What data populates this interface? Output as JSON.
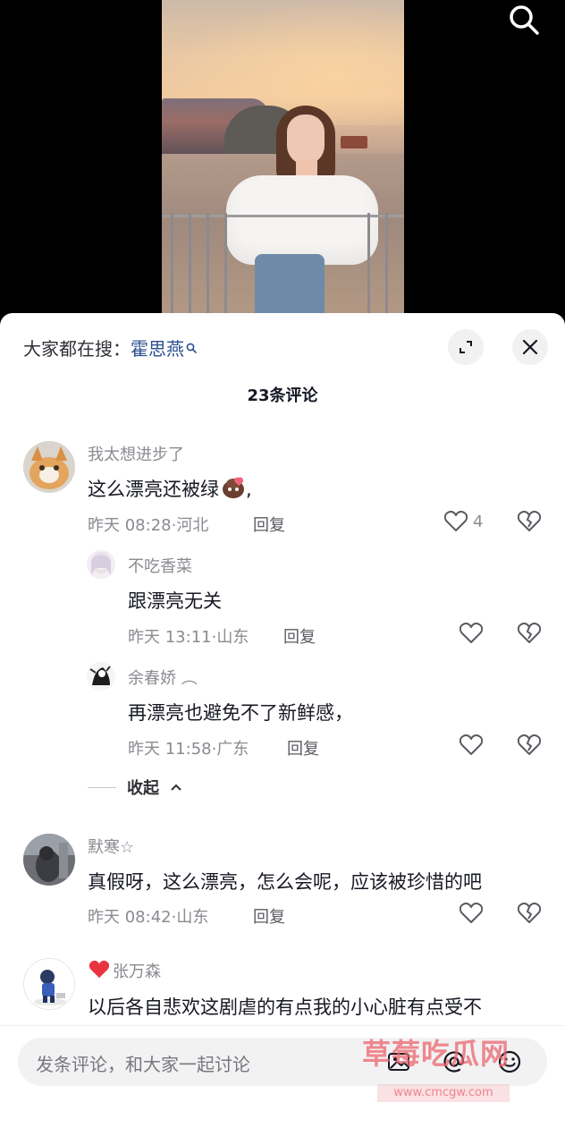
{
  "trending": {
    "label": "大家都在搜：",
    "keyword": "霍思燕"
  },
  "comments_count": "23条评论",
  "comments": [
    {
      "user": "我太想进步了",
      "text": "这么漂亮还被绿",
      "time": "昨天 08:28",
      "location": "河北",
      "reply": "回复",
      "likes": "4"
    },
    {
      "user": "不吃香菜",
      "text": "跟漂亮无关",
      "time": "昨天 13:11",
      "location": "山东",
      "reply": "回复"
    },
    {
      "user": "余春娇  ︵",
      "text": "再漂亮也避免不了新鲜感，",
      "time": "昨天 11:58",
      "location": "广东",
      "reply": "回复"
    },
    {
      "user": "默寒☆",
      "text": "真假呀，这么漂亮，怎么会呢，应该被珍惜的吧",
      "time": "昨天 08:42",
      "location": "山东",
      "reply": "回复"
    },
    {
      "user": "张万森",
      "text": "以后各自悲欢这剧虐的有点我的小心脏有点受不"
    }
  ],
  "collapse_label": "收起",
  "input": {
    "placeholder": "发条评论，和大家一起讨论"
  },
  "watermark": {
    "text": "草莓吃瓜网",
    "url": "www.cmcgw.com"
  },
  "colors": {
    "accent_link": "#2a4f8f",
    "heart": "#e8343f"
  }
}
